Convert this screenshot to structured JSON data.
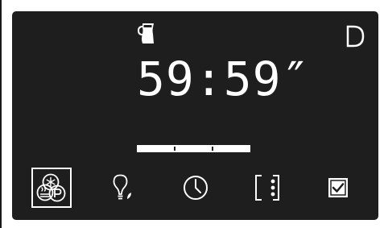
{
  "display": {
    "timer": "59:59″"
  },
  "status_icons": {
    "mode": "blender-jug-icon",
    "right": "d-letter-icon"
  },
  "progress": {
    "segments": 3,
    "filled_fraction": 1.0
  },
  "toolbar": [
    {
      "name": "defrost-proof-icon",
      "selected": true
    },
    {
      "name": "lamp-icon",
      "selected": false
    },
    {
      "name": "clock-icon",
      "selected": false
    },
    {
      "name": "more-options-icon",
      "selected": false
    },
    {
      "name": "confirm-checkbox-icon",
      "selected": false
    }
  ],
  "colors": {
    "background": "#1e1e1e",
    "foreground": "#ffffff"
  }
}
